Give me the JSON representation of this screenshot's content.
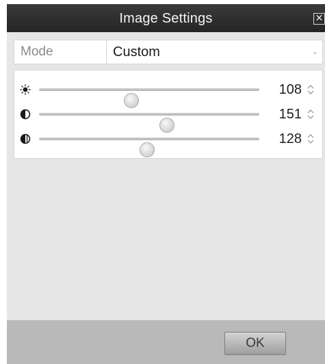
{
  "window": {
    "title": "Image Settings",
    "close_glyph": "✕"
  },
  "mode": {
    "label": "Mode",
    "value": "Custom",
    "arrow_glyph": "⌄"
  },
  "sliders": [
    {
      "name": "brightness",
      "icon": "brightness-icon",
      "value": "108",
      "level": 0.42
    },
    {
      "name": "contrast",
      "icon": "contrast-icon",
      "value": "151",
      "level": 0.58
    },
    {
      "name": "saturation",
      "icon": "saturation-icon",
      "value": "128",
      "level": 0.49
    }
  ],
  "footer": {
    "ok_label": "OK"
  },
  "colors": {
    "titlebar": "#2e2e2e",
    "panel": "#e6e6e6",
    "footer": "#b9b9b9"
  }
}
